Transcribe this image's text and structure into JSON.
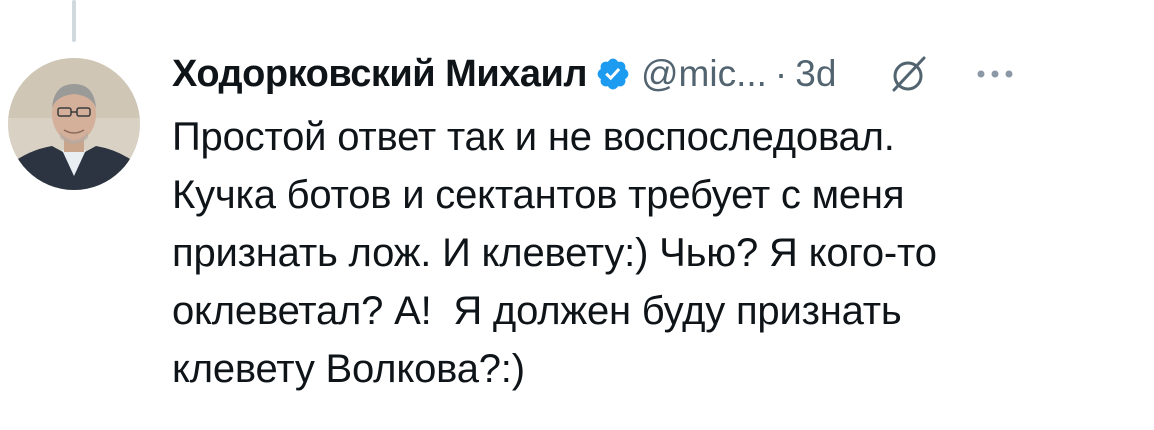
{
  "tweet": {
    "display_name": "Ходорковский Михаил",
    "handle": "@mic...",
    "separator": "·",
    "time": "3d",
    "text": "Простой ответ так и не воспоследовал.\nКучка ботов и сектантов требует с меня\nпризнать лож. И клевету:) Чью? Я кого-то\nоклеветал? А!  Я должен буду признать\nклевету Волкова?:)",
    "verified": true
  },
  "icons": {
    "verified": "verified-badge-icon",
    "grok": "grok-icon",
    "more": "more-icon"
  },
  "colors": {
    "verified_blue": "#1d9bf0",
    "text_primary": "#0f1419",
    "text_secondary": "#536471",
    "thread_line": "#cfd9de"
  }
}
